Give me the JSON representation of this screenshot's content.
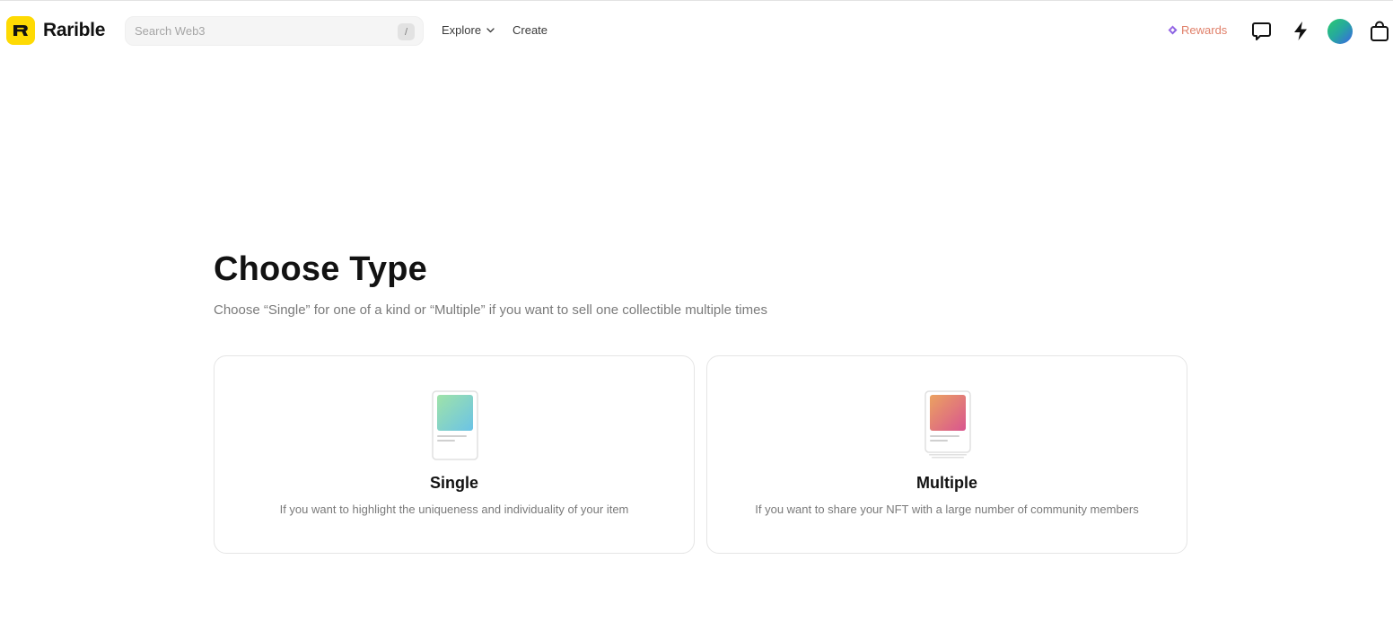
{
  "header": {
    "logo_text": "Rarible",
    "search": {
      "placeholder": "Search Web3",
      "shortcut": "/"
    },
    "nav": {
      "explore": "Explore",
      "create": "Create"
    },
    "rewards": "Rewards",
    "icons": [
      "chat-icon",
      "lightning-icon",
      "avatar",
      "bag-icon"
    ]
  },
  "main": {
    "title": "Choose Type",
    "subtitle": "Choose “Single” for one of a kind or “Multiple” if you want to sell one collectible multiple times",
    "cards": [
      {
        "title": "Single",
        "description": "If you want to highlight the uniqueness and individuality of your item"
      },
      {
        "title": "Multiple",
        "description": "If you want to share your NFT with a large number of community members"
      }
    ]
  },
  "colors": {
    "brand_yellow": "#FEDA03",
    "text_primary": "#121212",
    "text_secondary": "#7a7a7a",
    "rewards_gradient_start": "#a66ee8",
    "rewards_gradient_end": "#f0905c"
  }
}
